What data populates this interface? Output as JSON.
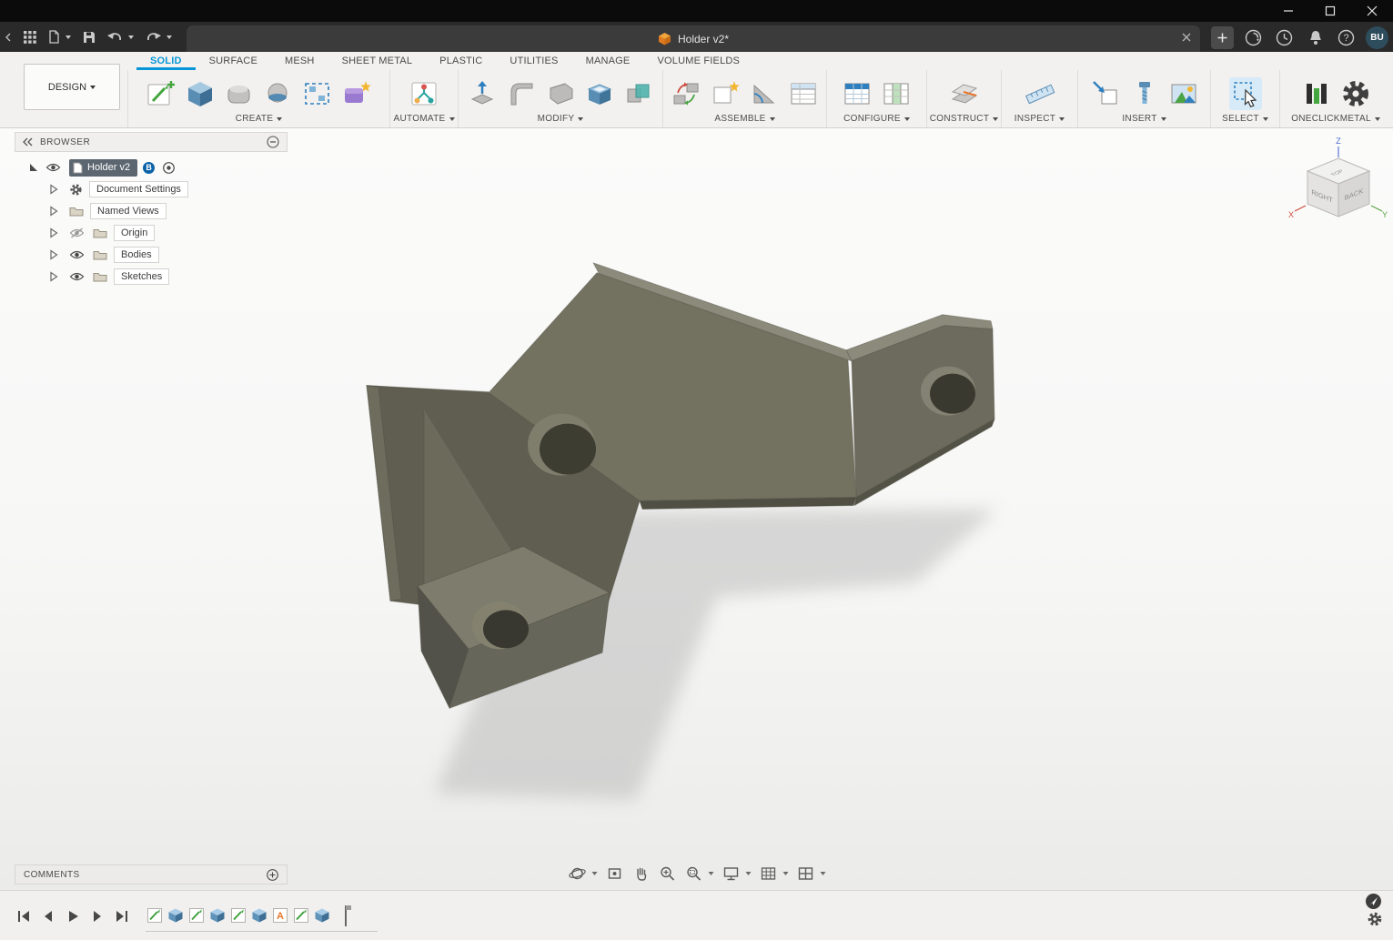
{
  "window": {
    "doc_title": "Holder v2*",
    "avatar": "BU",
    "help_glyph": "?"
  },
  "ribbon": {
    "design_label": "DESIGN",
    "tabs": [
      "SOLID",
      "SURFACE",
      "MESH",
      "SHEET METAL",
      "PLASTIC",
      "UTILITIES",
      "MANAGE",
      "VOLUME FIELDS"
    ],
    "groups": [
      "CREATE",
      "AUTOMATE",
      "MODIFY",
      "ASSEMBLE",
      "CONFIGURE",
      "CONSTRUCT",
      "INSPECT",
      "INSERT",
      "SELECT",
      "ONECLICKMETAL"
    ]
  },
  "browser": {
    "title": "BROWSER",
    "root": "Holder v2",
    "root_badge": "B",
    "items": [
      "Document Settings",
      "Named Views",
      "Origin",
      "Bodies",
      "Sketches"
    ]
  },
  "viewcube": {
    "top": "TOP",
    "right": "RIGHT",
    "back": "BACK",
    "x": "X",
    "y": "Y",
    "z": "Z"
  },
  "comments": {
    "label": "COMMENTS"
  },
  "timeline": {
    "text_feature_glyph": "A"
  },
  "colors": {
    "accent_blue": "#0696d7",
    "model_base": "#73715f",
    "model_dark": "#53524a",
    "model_light": "#8c8a7b",
    "selected_row": "#5c6670",
    "badge_blue": "#0c63a8",
    "canvas_top": "#fbfbfa",
    "canvas_bottom": "#ebebe9"
  }
}
